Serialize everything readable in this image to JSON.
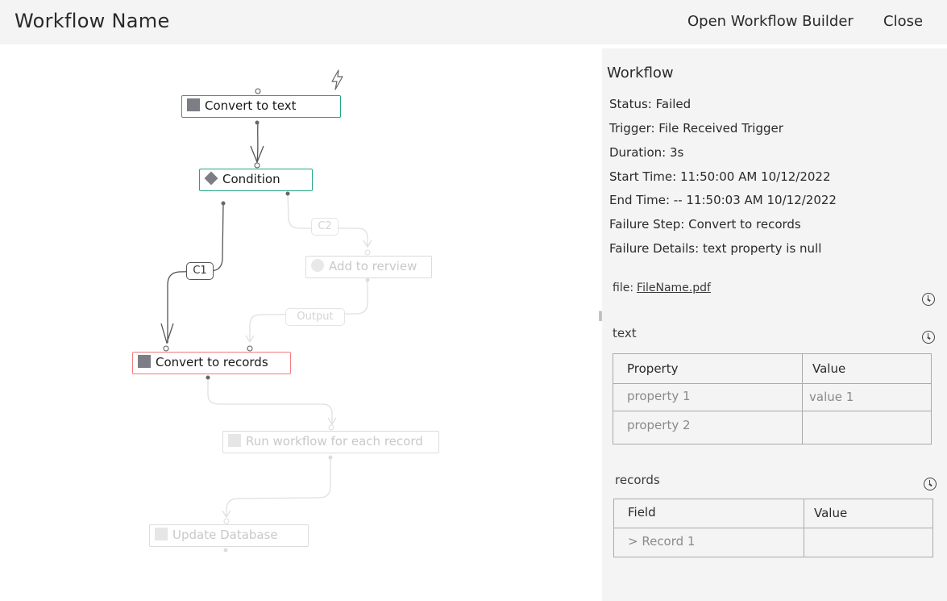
{
  "header": {
    "title": "Workflow Name",
    "open_builder_label": "Open Workflow Builder",
    "close_label": "Close"
  },
  "canvas": {
    "nodes": {
      "convert_text": "Convert to text",
      "condition": "Condition",
      "add_review": "Add to rerview",
      "convert_records": "Convert to records",
      "run_workflow": "Run workflow for each record",
      "update_db": "Update Database"
    },
    "edge_labels": {
      "c1": "C1",
      "c2": "C2",
      "output": "Output"
    },
    "trigger_icon": "lightning-bolt-icon"
  },
  "panel": {
    "title": "Workflow",
    "status": "Status: Failed",
    "trigger": "Trigger: File Received Trigger",
    "duration": "Duration: 3s",
    "start_time": "Start Time: 11:50:00 AM  10/12/2022",
    "end_time": "End Time: -- 11:50:03 AM  10/12/2022",
    "failure_step": "Failure Step: Convert to records",
    "failure_details": "Failure Details: text property is null",
    "file": {
      "label": "file:",
      "name": "FileName.pdf"
    },
    "text_section": {
      "label": "text",
      "headers": [
        "Property",
        "Value"
      ],
      "rows": [
        [
          "property 1",
          "value 1"
        ],
        [
          "property 2",
          ""
        ]
      ]
    },
    "records_section": {
      "label": "records",
      "headers": [
        "Field",
        "Value"
      ],
      "rows": [
        [
          "> Record 1",
          ""
        ]
      ]
    }
  },
  "colors": {
    "active_border": "#23a684",
    "failed_border": "#ef7e80",
    "pending": "#dcdcdc",
    "panel_bg": "#f4f4f4"
  }
}
